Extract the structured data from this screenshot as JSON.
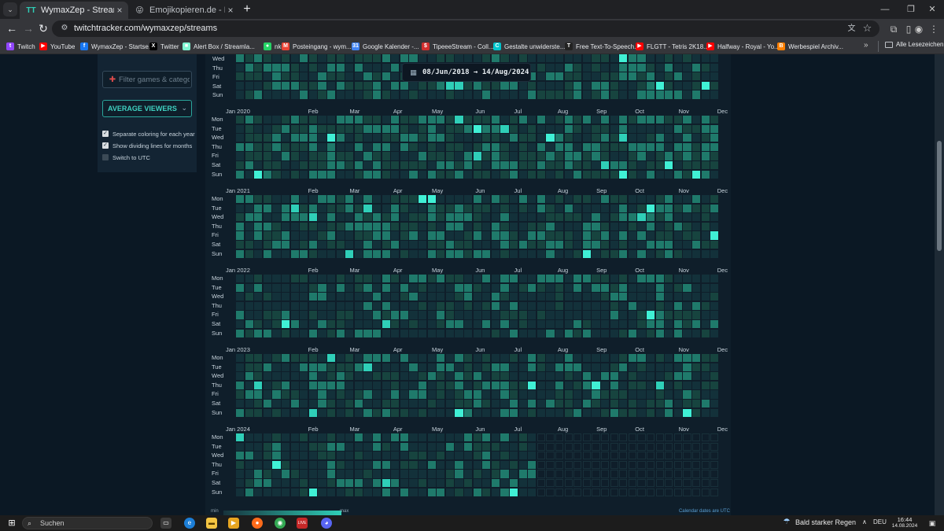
{
  "browser": {
    "tabs": [
      {
        "title": "WymaxZep - Streams List and S",
        "favicon": "TT",
        "active": true
      },
      {
        "title": "Emojikopieren.de - Emojis :",
        "favicon": "😜",
        "active": false
      }
    ],
    "address": "twitchtracker.com/wymaxzep/streams",
    "bookmarks": [
      {
        "label": "Twitch",
        "icon": "twitch-icon",
        "color": "#9146ff",
        "glyph": "t"
      },
      {
        "label": "YouTube",
        "icon": "youtube-icon",
        "color": "#ff0000",
        "glyph": "▶"
      },
      {
        "label": "WymaxZep - Startse...",
        "icon": "facebook-icon",
        "color": "#1877f2",
        "glyph": "f"
      },
      {
        "label": "Twitter",
        "icon": "x-icon",
        "color": "#000000",
        "glyph": "X"
      },
      {
        "label": "Alert Box / Streamla...",
        "icon": "streamlabs-icon",
        "color": "#80f5d2",
        "glyph": "■"
      },
      {
        "label": "nke",
        "icon": "whatsapp-icon",
        "color": "#25d366",
        "glyph": "●"
      },
      {
        "label": "Posteingang - wym...",
        "icon": "gmail-icon",
        "color": "#ea4335",
        "glyph": "M"
      },
      {
        "label": "Google Kalender -...",
        "icon": "calendar-icon",
        "color": "#4285f4",
        "glyph": "31"
      },
      {
        "label": "TipeeeStream - Coll...",
        "icon": "tipeee-icon",
        "color": "#d22e2e",
        "glyph": "$"
      },
      {
        "label": "Gestalte unwiderste...",
        "icon": "canva-icon",
        "color": "#00c4cc",
        "glyph": "C"
      },
      {
        "label": "Free Text-To-Speech...",
        "icon": "tts-icon",
        "color": "#222222",
        "glyph": "T"
      },
      {
        "label": "FLGTT - Tetris 2K18...",
        "icon": "youtube-icon",
        "color": "#ff0000",
        "glyph": "▶"
      },
      {
        "label": "Halfway - Royal - Yo...",
        "icon": "youtube-icon",
        "color": "#ff0000",
        "glyph": "▶"
      },
      {
        "label": "Werbespiel Archiv...",
        "icon": "blogger-icon",
        "color": "#ff8000",
        "glyph": "B"
      }
    ],
    "bookmarks_more": "»",
    "all_bookmarks": "Alle Lesezeichen"
  },
  "sidebar": {
    "filter_placeholder": "Filter games & categor",
    "metric": "AVERAGE VIEWERS",
    "options": [
      {
        "label": "Separate coloring for each year",
        "checked": true
      },
      {
        "label": "Show dividing lines for months",
        "checked": true
      },
      {
        "label": "Switch to UTC",
        "checked": false
      }
    ]
  },
  "date_range": "08/Jun/2018 → 14/Aug/2024",
  "calendar": {
    "day_labels": [
      "Mon",
      "Tue",
      "Wed",
      "Thu",
      "Fri",
      "Sat",
      "Sun"
    ],
    "top_partial_days": [
      "Wed",
      "Thu",
      "Fri",
      "Sat",
      "Sun"
    ],
    "years": [
      {
        "label": "Jan 2020",
        "months": [
          "Feb",
          "Mar",
          "Apr",
          "May",
          "Jun",
          "Jul",
          "Aug",
          "Sep",
          "Oct",
          "Nov",
          "Dec"
        ]
      },
      {
        "label": "Jan 2021",
        "months": [
          "Feb",
          "Mar",
          "Apr",
          "May",
          "Jun",
          "Jul",
          "Aug",
          "Sep",
          "Oct",
          "Nov",
          "Dec"
        ]
      },
      {
        "label": "Jan 2022",
        "months": [
          "Feb",
          "Mar",
          "Apr",
          "May",
          "Jun",
          "Jul",
          "Aug",
          "Sep",
          "Oct",
          "Nov",
          "Dec"
        ]
      },
      {
        "label": "Jan 2023",
        "months": [
          "Feb",
          "Mar",
          "Apr",
          "May",
          "Jun",
          "Jul",
          "Aug",
          "Sep",
          "Oct",
          "Nov",
          "Dec"
        ]
      },
      {
        "label": "Jan 2024",
        "months": [
          "Feb",
          "Mar",
          "Apr",
          "May",
          "Jun",
          "Jul",
          "Aug",
          "Sep",
          "Oct",
          "Nov",
          "Dec"
        ]
      }
    ],
    "legend_min": "min",
    "legend_max": "max",
    "utc_note": "Calendar dates are UTC",
    "colors": {
      "empty": "#13313a",
      "low": "#17443f",
      "mid": "#1f7a6b",
      "high": "#2fcfb8",
      "peak": "#40f0d5"
    }
  },
  "taskbar": {
    "search": "Suchen",
    "weather": "Bald starker Regen",
    "lang": "DEU",
    "time": "16:44",
    "date": "14.08.2024"
  }
}
